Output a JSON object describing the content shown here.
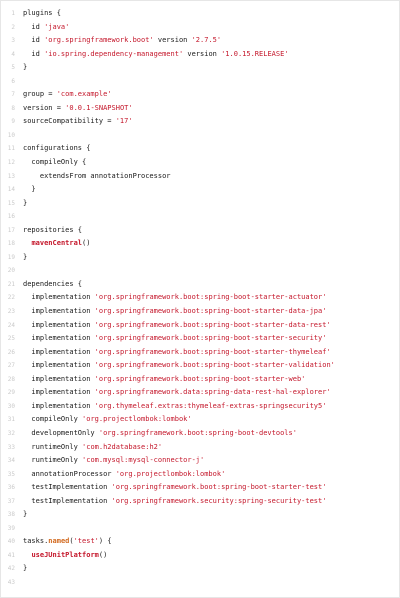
{
  "code_lines": [
    [
      {
        "t": "plugins {"
      }
    ],
    [
      {
        "t": "  id "
      },
      {
        "t": "'java'",
        "c": "str"
      }
    ],
    [
      {
        "t": "  id "
      },
      {
        "t": "'org.springframework.boot'",
        "c": "str"
      },
      {
        "t": " version "
      },
      {
        "t": "'2.7.5'",
        "c": "str"
      }
    ],
    [
      {
        "t": "  id "
      },
      {
        "t": "'io.spring.dependency-management'",
        "c": "str"
      },
      {
        "t": " version "
      },
      {
        "t": "'1.0.15.RELEASE'",
        "c": "str"
      }
    ],
    [
      {
        "t": "}"
      }
    ],
    [],
    [
      {
        "t": "group = "
      },
      {
        "t": "'com.example'",
        "c": "str"
      }
    ],
    [
      {
        "t": "version = "
      },
      {
        "t": "'0.0.1-SNAPSHOT'",
        "c": "str"
      }
    ],
    [
      {
        "t": "sourceCompatibility = "
      },
      {
        "t": "'17'",
        "c": "str"
      }
    ],
    [],
    [
      {
        "t": "configurations {"
      }
    ],
    [
      {
        "t": "  compileOnly {"
      }
    ],
    [
      {
        "t": "    extendsFrom annotationProcessor"
      }
    ],
    [
      {
        "t": "  }"
      }
    ],
    [
      {
        "t": "}"
      }
    ],
    [],
    [
      {
        "t": "repositories {"
      }
    ],
    [
      {
        "t": "  "
      },
      {
        "t": "mavenCentral",
        "c": "fn"
      },
      {
        "t": "()"
      }
    ],
    [
      {
        "t": "}"
      }
    ],
    [],
    [
      {
        "t": "dependencies {"
      }
    ],
    [
      {
        "t": "  implementation "
      },
      {
        "t": "'org.springframework.boot:spring-boot-starter-actuator'",
        "c": "str"
      }
    ],
    [
      {
        "t": "  implementation "
      },
      {
        "t": "'org.springframework.boot:spring-boot-starter-data-jpa'",
        "c": "str"
      }
    ],
    [
      {
        "t": "  implementation "
      },
      {
        "t": "'org.springframework.boot:spring-boot-starter-data-rest'",
        "c": "str"
      }
    ],
    [
      {
        "t": "  implementation "
      },
      {
        "t": "'org.springframework.boot:spring-boot-starter-security'",
        "c": "str"
      }
    ],
    [
      {
        "t": "  implementation "
      },
      {
        "t": "'org.springframework.boot:spring-boot-starter-thymeleaf'",
        "c": "str"
      }
    ],
    [
      {
        "t": "  implementation "
      },
      {
        "t": "'org.springframework.boot:spring-boot-starter-validation'",
        "c": "str"
      }
    ],
    [
      {
        "t": "  implementation "
      },
      {
        "t": "'org.springframework.boot:spring-boot-starter-web'",
        "c": "str"
      }
    ],
    [
      {
        "t": "  implementation "
      },
      {
        "t": "'org.springframework.data:spring-data-rest-hal-explorer'",
        "c": "str"
      }
    ],
    [
      {
        "t": "  implementation "
      },
      {
        "t": "'org.thymeleaf.extras:thymeleaf-extras-springsecurity5'",
        "c": "str"
      }
    ],
    [
      {
        "t": "  compileOnly "
      },
      {
        "t": "'org.projectlombok:lombok'",
        "c": "str"
      }
    ],
    [
      {
        "t": "  developmentOnly "
      },
      {
        "t": "'org.springframework.boot:spring-boot-devtools'",
        "c": "str"
      }
    ],
    [
      {
        "t": "  runtimeOnly "
      },
      {
        "t": "'com.h2database:h2'",
        "c": "str"
      }
    ],
    [
      {
        "t": "  runtimeOnly "
      },
      {
        "t": "'com.mysql:mysql-connector-j'",
        "c": "str"
      }
    ],
    [
      {
        "t": "  annotationProcessor "
      },
      {
        "t": "'org.projectlombok:lombok'",
        "c": "str"
      }
    ],
    [
      {
        "t": "  testImplementation "
      },
      {
        "t": "'org.springframework.boot:spring-boot-starter-test'",
        "c": "str"
      }
    ],
    [
      {
        "t": "  testImplementation "
      },
      {
        "t": "'org.springframework.security:spring-security-test'",
        "c": "str"
      }
    ],
    [
      {
        "t": "}"
      }
    ],
    [],
    [
      {
        "t": "tasks."
      },
      {
        "t": "named",
        "c": "fn2"
      },
      {
        "t": "("
      },
      {
        "t": "'test'",
        "c": "str"
      },
      {
        "t": ") {"
      }
    ],
    [
      {
        "t": "  "
      },
      {
        "t": "useJUnitPlatform",
        "c": "fn"
      },
      {
        "t": "()"
      }
    ],
    [
      {
        "t": "}"
      }
    ],
    []
  ],
  "colors": {
    "string": "#c4162a",
    "function": "#c4162a",
    "method": "#d2691e",
    "line_number": "#c9c9c9",
    "text": "#1a1a1a"
  }
}
